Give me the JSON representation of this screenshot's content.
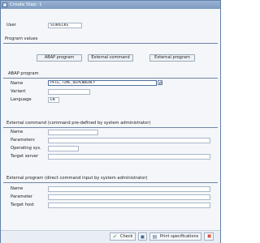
{
  "window": {
    "title": "Create Step: 1"
  },
  "user": {
    "label": "User",
    "value": "SCHRECKS"
  },
  "program_values": {
    "heading": "Program values",
    "buttons": [
      "ABAP program",
      "External command",
      "External program"
    ]
  },
  "abap": {
    "heading": "ABAP program",
    "name_label": "Name",
    "name_value": "PFCG_TIME_DEPENDENCY",
    "variant_label": "Variant",
    "variant_value": "",
    "language_label": "Language",
    "language_value": "EN"
  },
  "external_command": {
    "heading": "External command (command pre-defined by system administrator)",
    "name_label": "Name",
    "parameters_label": "Parameters",
    "os_label": "Operating sys.",
    "target_label": "Target server"
  },
  "external_program": {
    "heading": "External program (direct command input by system administrator)",
    "name_label": "Name",
    "parameter_label": "Parameter",
    "host_label": "Target host"
  },
  "footer": {
    "check_label": "Check",
    "print_label": "Print specifications"
  },
  "colors": {
    "title_bar": "#8aa5c9",
    "check_green": "#2e8b2e",
    "cancel_red": "#d43a2a"
  }
}
